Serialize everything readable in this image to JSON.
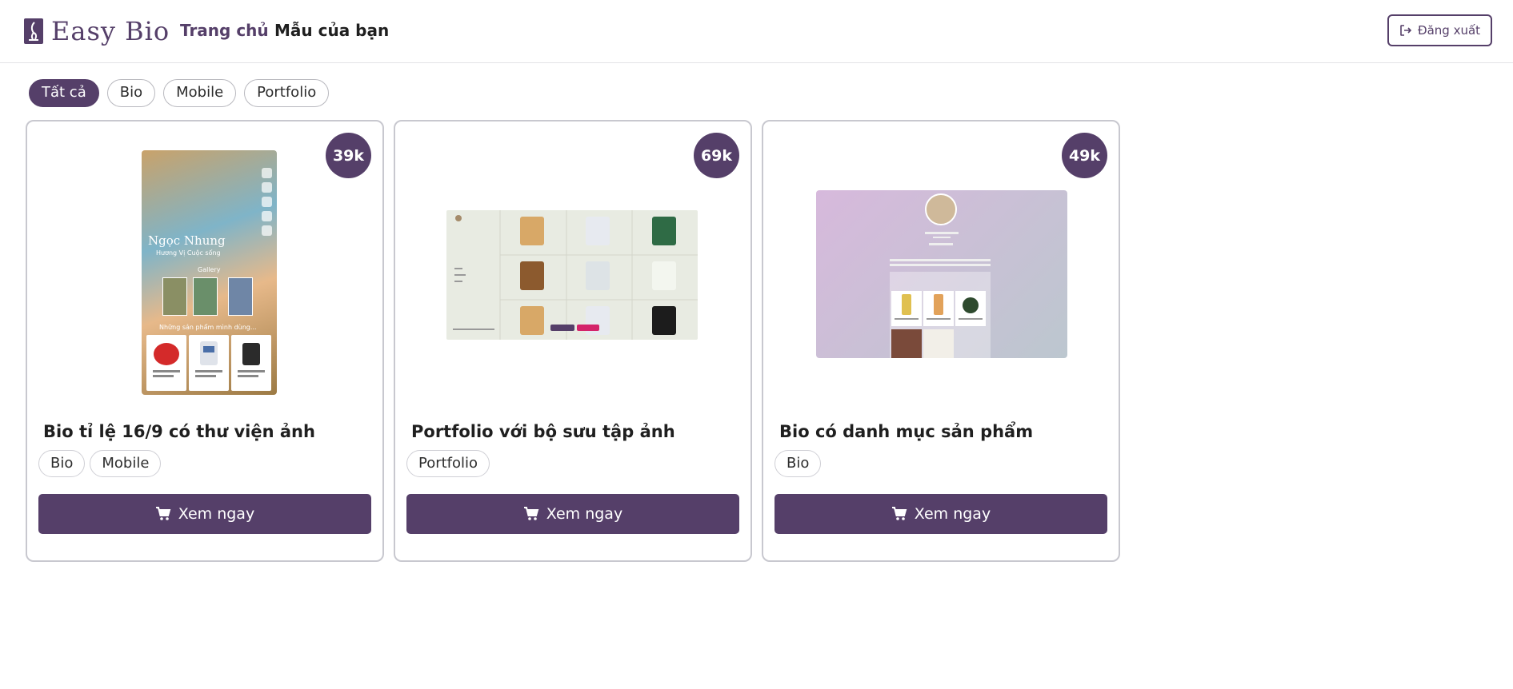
{
  "header": {
    "logo_text": "Easy Bio",
    "nav": [
      {
        "label": "Trang chủ"
      },
      {
        "label": "Mẫu của bạn"
      }
    ],
    "logout_label": "Đăng xuất"
  },
  "filters": [
    {
      "label": "Tất cả",
      "active": true
    },
    {
      "label": "Bio",
      "active": false
    },
    {
      "label": "Mobile",
      "active": false
    },
    {
      "label": "Portfolio",
      "active": false
    }
  ],
  "cards": [
    {
      "title": "Bio tỉ lệ 16/9 có thư viện ảnh",
      "price": "39k",
      "tags": [
        "Bio",
        "Mobile"
      ],
      "button_label": "Xem ngay",
      "preview": {
        "name": "Ngọc Nhung",
        "subtitle": "Hương Vị Cuộc sống",
        "gallery_label": "Gallery",
        "products_label": "Những sản phẩm mình dùng..."
      }
    },
    {
      "title": "Portfolio với bộ sưu tập ảnh",
      "price": "69k",
      "tags": [
        "Portfolio"
      ],
      "button_label": "Xem ngay"
    },
    {
      "title": "Bio có danh mục sản phẩm",
      "price": "49k",
      "tags": [
        "Bio"
      ],
      "button_label": "Xem ngay"
    }
  ],
  "colors": {
    "brand": "#553f69",
    "border": "#c8c8cf"
  },
  "icons": {
    "logo": "logo-icon",
    "logout": "logout-icon",
    "cart": "cart-icon"
  }
}
